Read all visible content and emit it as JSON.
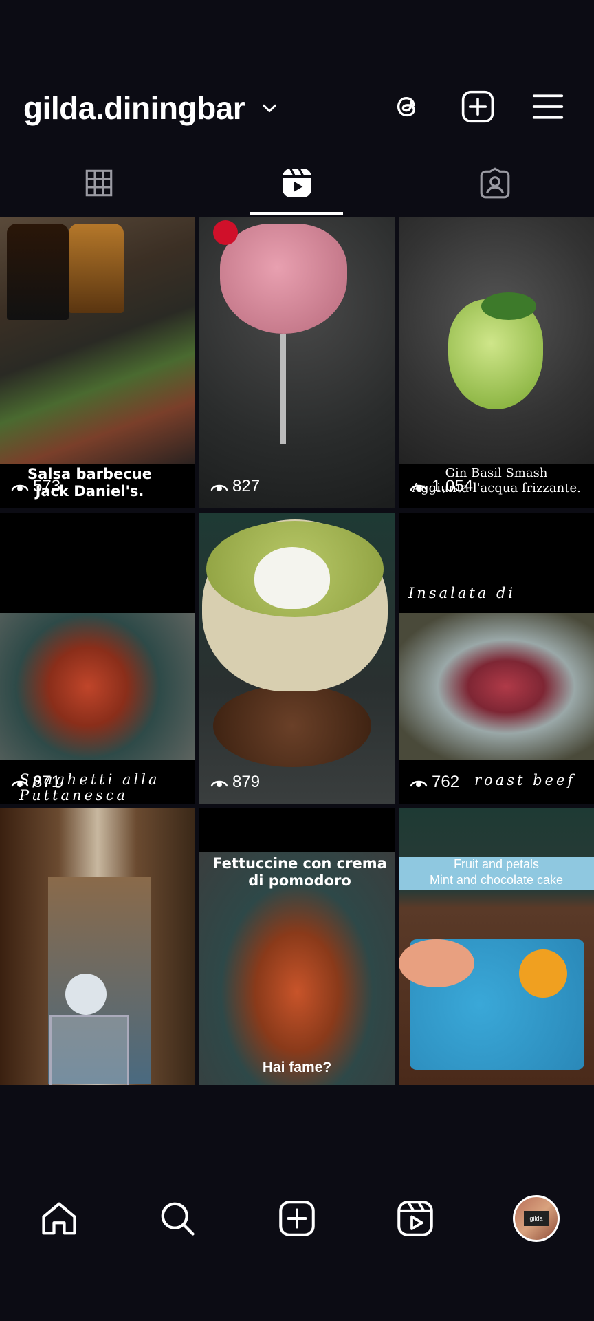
{
  "profile": {
    "username": "gilda.diningbar"
  },
  "header_icons": [
    "threads-icon",
    "create-post-icon",
    "menu-icon"
  ],
  "tabs": [
    {
      "name": "grid-tab",
      "icon": "grid-icon",
      "active": false
    },
    {
      "name": "reels-tab",
      "icon": "reels-icon",
      "active": true
    },
    {
      "name": "tagged-tab",
      "icon": "tagged-icon",
      "active": false
    }
  ],
  "reels": [
    {
      "caption": "Salsa barbecue\nJack Daniel's.",
      "views": "573"
    },
    {
      "caption": "",
      "views": "827"
    },
    {
      "caption": "Gin Basil Smash\nAggiunta l'acqua frizzante.",
      "views": "1,054"
    },
    {
      "caption": "Spaghetti alla\nPuttanesca",
      "views": "871"
    },
    {
      "caption": "",
      "views": "879"
    },
    {
      "caption_top": "Insalata di",
      "caption": "roast beef",
      "views": "762"
    },
    {
      "caption": "",
      "views": ""
    },
    {
      "caption": "Fettuccine con crema\ndi pomodoro",
      "caption_bottom": "Hai fame?",
      "views": ""
    },
    {
      "caption": "Fruit and petals\nMint and chocolate cake",
      "views": ""
    }
  ],
  "bottom_nav": [
    "home-icon",
    "search-icon",
    "create-icon",
    "reels-nav-icon",
    "profile-avatar"
  ],
  "avatar_text": "gilda",
  "colors": {
    "background": "#0c0c14",
    "text": "#ffffff"
  }
}
